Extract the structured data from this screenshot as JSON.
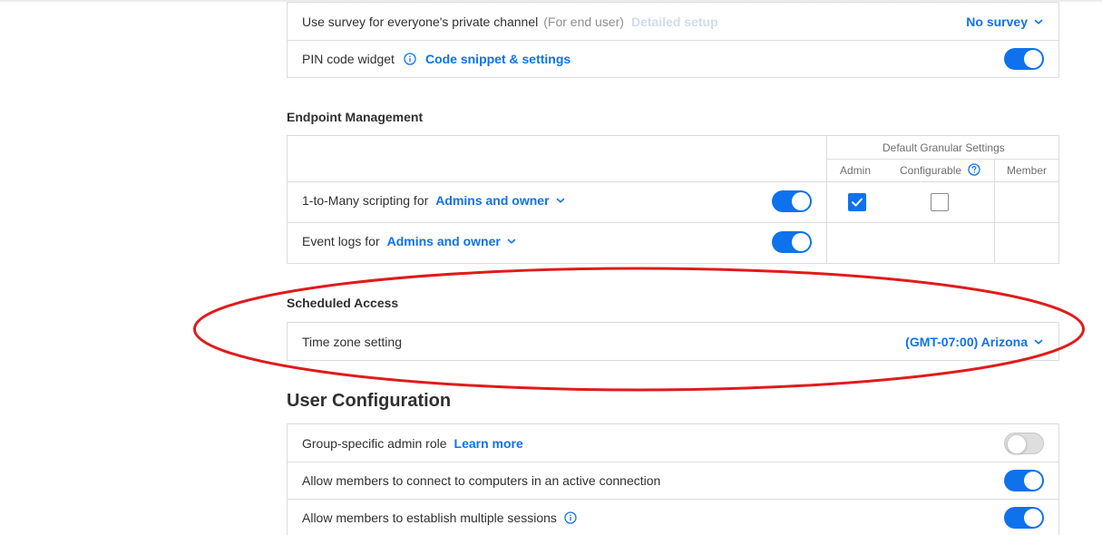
{
  "colors": {
    "accent": "#0e72ed",
    "annotation": "#e01b1b",
    "border": "#dcdcdc"
  },
  "top_panel": {
    "survey_row": {
      "label": "Use survey for everyone's private channel",
      "hint": "(For end user)",
      "setup_link": "Detailed setup",
      "value": "No survey"
    },
    "pin_row": {
      "label": "PIN code widget",
      "link": "Code snippet & settings",
      "toggle_on": true
    }
  },
  "endpoint": {
    "heading": "Endpoint Management",
    "granular_header": "Default Granular Settings",
    "columns": {
      "admin": "Admin",
      "configurable": "Configurable",
      "member": "Member"
    },
    "rows": [
      {
        "label": "1-to-Many scripting for",
        "value": "Admins and owner",
        "toggle_on": true,
        "admin_checked": true,
        "configurable_checked": false
      },
      {
        "label": "Event logs for",
        "value": "Admins and owner",
        "toggle_on": true
      }
    ]
  },
  "scheduled": {
    "heading": "Scheduled Access",
    "row": {
      "label": "Time zone setting",
      "value": "(GMT-07:00) Arizona"
    }
  },
  "user_config": {
    "heading": "User Configuration",
    "rows": [
      {
        "label": "Group-specific admin role",
        "link": "Learn more",
        "toggle_on": false
      },
      {
        "label": "Allow members to connect to computers in an active connection",
        "toggle_on": true
      },
      {
        "label": "Allow members to establish multiple sessions",
        "toggle_on": true
      }
    ]
  }
}
